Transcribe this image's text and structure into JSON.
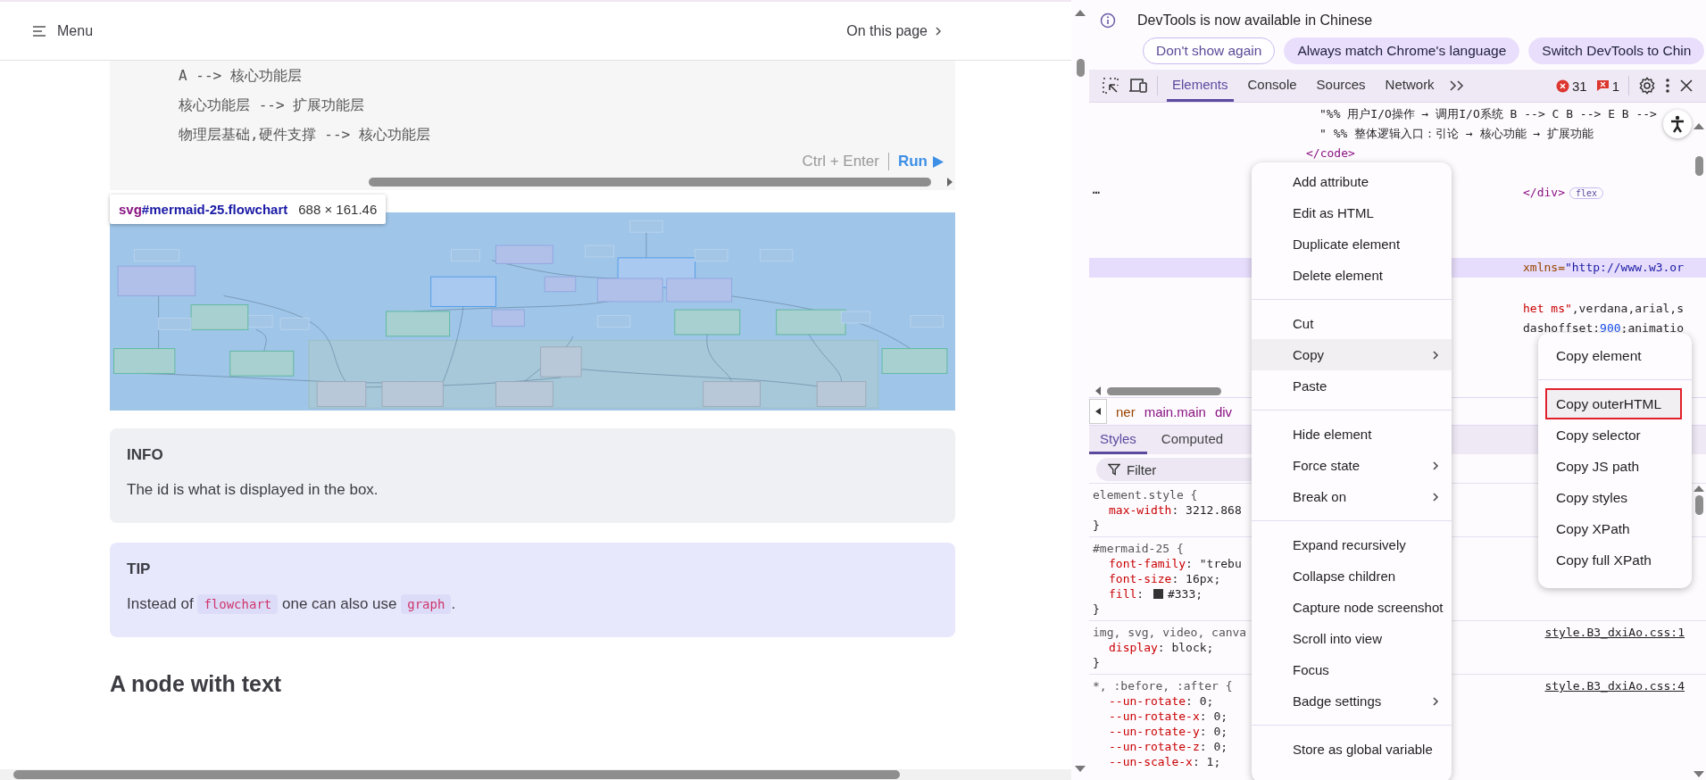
{
  "page": {
    "header": {
      "menu_label": "Menu",
      "toc_label": "On this page"
    },
    "code_block": {
      "lines": [
        "A --> 核心功能层",
        "核心功能层 --> 扩展功能层",
        "物理层基础,硬件支撑 --> 核心功能层"
      ],
      "shortcut": "Ctrl + Enter",
      "run_label": "Run"
    },
    "element_tooltip": {
      "tag": "svg",
      "selector": "#mermaid-25.flowchart",
      "size": "688 × 161.46"
    },
    "callouts": [
      {
        "kind": "info",
        "title": "INFO",
        "parts": [
          {
            "kind": "text",
            "text": "The id is what is displayed in the box."
          }
        ]
      },
      {
        "kind": "tip",
        "title": "TIP",
        "parts": [
          {
            "kind": "text",
            "text": "Instead of "
          },
          {
            "kind": "code",
            "text": "flowchart"
          },
          {
            "kind": "text",
            "text": " one can also use "
          },
          {
            "kind": "code",
            "text": "graph"
          },
          {
            "kind": "text",
            "text": "."
          }
        ]
      }
    ],
    "heading": "A node with text"
  },
  "devtools": {
    "infobar": {
      "message": "DevTools is now available in Chinese",
      "buttons": [
        {
          "label": "Don't show again",
          "kind": "outlined"
        },
        {
          "label": "Always match Chrome's language",
          "kind": "filled"
        },
        {
          "label": "Switch DevTools to Chin",
          "kind": "filled"
        }
      ]
    },
    "tabs": [
      {
        "label": "Elements",
        "selected": true
      },
      {
        "label": "Console",
        "selected": false
      },
      {
        "label": "Sources",
        "selected": false
      },
      {
        "label": "Network",
        "selected": false
      }
    ],
    "error_count": "31",
    "issue_count": "1",
    "dom_lines": [
      {
        "kind": "text",
        "selected": false,
        "segments": [
          {
            "kind": "plain",
            "text": "\"%% 用户I/O操作 → 调用I/O系统 B --> C B --> E B -->"
          }
        ]
      },
      {
        "kind": "text",
        "selected": false,
        "segments": [
          {
            "kind": "plain",
            "text": "\" %% 整体逻辑入口：引论 → 核心功能 → 扩展功能"
          }
        ]
      },
      {
        "kind": "tag",
        "selected": false,
        "segments": [
          {
            "kind": "tag",
            "text": "</code>"
          }
        ]
      },
      {
        "kind": "fragment",
        "selected": false,
        "segments": [
          {
            "kind": "ellipsis",
            "text": "⋯"
          },
          {
            "kind": "tag",
            "text": "</div>"
          },
          {
            "kind": "badge",
            "text": "flex"
          }
        ]
      },
      {
        "kind": "fragment",
        "selected": true,
        "segments": [
          {
            "kind": "attr",
            "text": "xmlns="
          },
          {
            "kind": "value",
            "text": "\"http://www.w3.or"
          }
        ]
      },
      {
        "kind": "fragment",
        "selected": false,
        "segments": [
          {
            "kind": "string",
            "text": "het ms\""
          },
          {
            "kind": "plain",
            "text": ",verdana,arial,s"
          }
        ]
      },
      {
        "kind": "fragment",
        "selected": false,
        "segments": [
          {
            "kind": "plain",
            "text": "dashoffset:"
          },
          {
            "kind": "number",
            "text": "900"
          },
          {
            "kind": "plain",
            "text": ";animatio"
          }
        ]
      }
    ],
    "breadcrumbs": [
      {
        "text": "ner",
        "kind": "orange"
      },
      {
        "text": "main.main",
        "kind": "tag"
      },
      {
        "text": "div",
        "kind": "tag"
      }
    ],
    "styles_tabs": [
      {
        "label": "Styles",
        "selected": true
      },
      {
        "label": "Computed",
        "selected": false
      }
    ],
    "filter_placeholder": "Filter",
    "rules": [
      {
        "selector": "element.style {",
        "declarations": [
          {
            "property": "max-width",
            "value": ": 3212.868"
          }
        ],
        "close": "}"
      },
      {
        "selector": "#mermaid-25 {",
        "declarations": [
          {
            "property": "font-family",
            "value": ": \"trebu"
          },
          {
            "property": "font-size",
            "value": ": 16px;"
          },
          {
            "property": "fill",
            "value": ": #333;",
            "color": "#333333"
          }
        ],
        "close": "}"
      },
      {
        "selector": "img, svg, video, canva",
        "source": "style.B3_dxiAo.css:1",
        "declarations": [
          {
            "property": "display",
            "value": ": block;"
          }
        ],
        "close": "}"
      },
      {
        "selector": "*, :before, :after {",
        "source": "style.B3_dxiAo.css:4",
        "declarations": [
          {
            "property": "--un-rotate",
            "value": ": 0;"
          },
          {
            "property": "--un-rotate-x",
            "value": ": 0;"
          },
          {
            "property": "--un-rotate-y",
            "value": ": 0;"
          },
          {
            "property": "--un-rotate-z",
            "value": ": 0;"
          },
          {
            "property": "--un-scale-x",
            "value": ": 1;"
          }
        ]
      }
    ],
    "context_menu": {
      "groups": [
        [
          {
            "label": "Add attribute",
            "kind": "action",
            "selected": false
          },
          {
            "label": "Edit as HTML",
            "kind": "action",
            "selected": false
          },
          {
            "label": "Duplicate element",
            "kind": "action",
            "selected": false
          },
          {
            "label": "Delete element",
            "kind": "action",
            "selected": false
          }
        ],
        [
          {
            "label": "Cut",
            "kind": "action",
            "selected": false
          },
          {
            "label": "Copy",
            "kind": "submenu",
            "selected": true
          },
          {
            "label": "Paste",
            "kind": "action",
            "selected": false
          }
        ],
        [
          {
            "label": "Hide element",
            "kind": "action",
            "selected": false
          },
          {
            "label": "Force state",
            "kind": "submenu",
            "selected": false
          },
          {
            "label": "Break on",
            "kind": "submenu",
            "selected": false
          }
        ],
        [
          {
            "label": "Expand recursively",
            "kind": "action",
            "selected": false
          },
          {
            "label": "Collapse children",
            "kind": "action",
            "selected": false
          },
          {
            "label": "Capture node screenshot",
            "kind": "action",
            "selected": false
          },
          {
            "label": "Scroll into view",
            "kind": "action",
            "selected": false
          },
          {
            "label": "Focus",
            "kind": "action",
            "selected": false
          },
          {
            "label": "Badge settings",
            "kind": "submenu",
            "selected": false
          }
        ],
        [
          {
            "label": "Store as global variable",
            "kind": "action",
            "selected": false
          }
        ]
      ]
    },
    "copy_submenu": {
      "groups": [
        [
          {
            "label": "Copy element",
            "selected": false,
            "annotated": false
          }
        ],
        [
          {
            "label": "Copy outerHTML",
            "selected": true,
            "annotated": true
          },
          {
            "label": "Copy selector",
            "selected": false,
            "annotated": false
          },
          {
            "label": "Copy JS path",
            "selected": false,
            "annotated": false
          },
          {
            "label": "Copy styles",
            "selected": false,
            "annotated": false
          },
          {
            "label": "Copy XPath",
            "selected": false,
            "annotated": false
          },
          {
            "label": "Copy full XPath",
            "selected": false,
            "annotated": false
          }
        ]
      ]
    }
  }
}
